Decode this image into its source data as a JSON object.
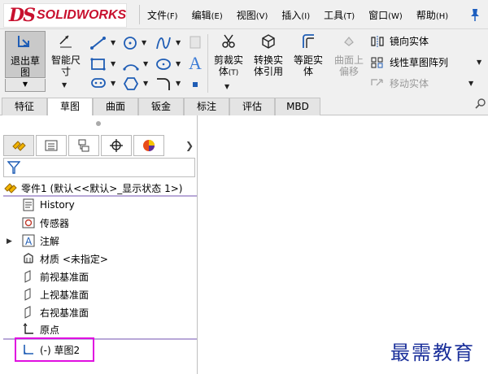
{
  "app": {
    "logo_prefix": "DS",
    "logo_text": "SOLIDWORKS",
    "brand_color": "#c8102e"
  },
  "menubar": [
    {
      "label": "文件",
      "hotkey": "(F)"
    },
    {
      "label": "编辑",
      "hotkey": "(E)"
    },
    {
      "label": "视图",
      "hotkey": "(V)"
    },
    {
      "label": "插入",
      "hotkey": "(I)"
    },
    {
      "label": "工具",
      "hotkey": "(T)"
    },
    {
      "label": "窗口",
      "hotkey": "(W)"
    },
    {
      "label": "帮助",
      "hotkey": "(H)"
    }
  ],
  "commands": {
    "exit_sketch": "退出草\n图",
    "smart_dimension": "智能尺\n寸",
    "trim_entities": "剪裁实\n体",
    "trim_hotkey": "(T)",
    "convert_entities": "转换实\n体引用",
    "offset_entities": "等距实\n体",
    "offset_on_surface": "曲面上\n偏移",
    "mirror_entities": "镜向实体",
    "linear_pattern": "线性草图阵列",
    "move_entities": "移动实体"
  },
  "tabs": [
    "特征",
    "草图",
    "曲面",
    "钣金",
    "标注",
    "评估",
    "MBD"
  ],
  "active_tab": "草图",
  "feature_tree": {
    "root_label": "零件1  (默认<<默认>_显示状态 1>)",
    "items": [
      {
        "label": "History",
        "icon": "history-icon"
      },
      {
        "label": "传感器",
        "icon": "sensor-icon"
      },
      {
        "label": "注解",
        "icon": "annotation-icon"
      },
      {
        "label": "材质 <未指定>",
        "icon": "material-icon"
      },
      {
        "label": "前视基准面",
        "icon": "plane-icon"
      },
      {
        "label": "上视基准面",
        "icon": "plane-icon"
      },
      {
        "label": "右视基准面",
        "icon": "plane-icon"
      },
      {
        "label": "原点",
        "icon": "origin-icon"
      },
      {
        "label": "(-) 草图2",
        "icon": "sketch-icon"
      }
    ]
  },
  "watermark": "最需教育",
  "colors": {
    "highlight": "#e010e0",
    "watermark": "#1a2f9a"
  }
}
